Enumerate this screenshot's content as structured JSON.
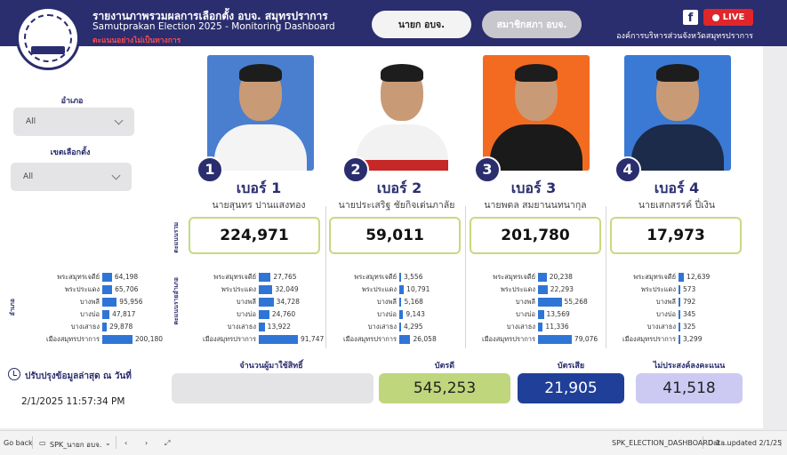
{
  "header": {
    "title": "รายงานภาพรวมผลการเลือกตั้ง อบจ. สมุทรปราการ",
    "subtitle": "Samutprakan Election 2025 - Monitoring Dashboard",
    "warning": "ตะแนนอย่างไม่เป็นทางการ",
    "tab_mayor": "นายก อบจ.",
    "tab_council": "สมาชิกสภา อบจ.",
    "live_label": "LIVE",
    "org": "องค์การบริหารส่วนจังหวัดสมุทรปราการ"
  },
  "filters": {
    "district_label": "อำเภอ",
    "district_value": "All",
    "zone_label": "เขตเลือกตั้ง",
    "zone_value": "All"
  },
  "side_labels": {
    "total": "ตะแนนรวม",
    "by_district_a": "อำเภอ",
    "by_district_b": "คะแนนรายอำเภอ"
  },
  "districts": [
    "พระสมุทรเจดีย์",
    "พระประแดง",
    "บางพลี",
    "บางบ่อ",
    "บางเสาธง",
    "เมืองสมุทรปราการ"
  ],
  "district_totals": [
    64198,
    65706,
    95956,
    47817,
    29878,
    200180
  ],
  "district_totals_text": [
    "64,198",
    "65,706",
    "95,956",
    "47,817",
    "29,878",
    "200,180"
  ],
  "candidates": [
    {
      "badge": "1",
      "number_label": "เบอร์ 1",
      "name": "นายสุนทร ปานแสงทอง",
      "total": "224,971",
      "district_values": [
        27765,
        32049,
        34728,
        24760,
        13922,
        91747
      ],
      "district_text": [
        "27,765",
        "32,049",
        "34,728",
        "24,760",
        "13,922",
        "91,747"
      ]
    },
    {
      "badge": "2",
      "number_label": "เบอร์ 2",
      "name": "นายประเสริฐ ชัยกิจเด่นภาลัย",
      "total": "59,011",
      "district_values": [
        3556,
        10791,
        5168,
        9143,
        4295,
        26058
      ],
      "district_text": [
        "3,556",
        "10,791",
        "5,168",
        "9,143",
        "4,295",
        "26,058"
      ]
    },
    {
      "badge": "3",
      "number_label": "เบอร์ 3",
      "name": "นายพดล สมยานนทนากุล",
      "total": "201,780",
      "district_values": [
        20238,
        22293,
        55268,
        13569,
        11336,
        79076
      ],
      "district_text": [
        "20,238",
        "22,293",
        "55,268",
        "13,569",
        "11,336",
        "79,076"
      ]
    },
    {
      "badge": "4",
      "number_label": "เบอร์ 4",
      "name": "นายเสกสรรค์ ปี่เงิน",
      "total": "17,973",
      "district_values": [
        12639,
        573,
        792,
        345,
        325,
        3299
      ],
      "district_text": [
        "12,639",
        "573",
        "792",
        "345",
        "325",
        "3,299"
      ]
    }
  ],
  "update": {
    "label": "ปรับปรุงข้อมูลล่าสุด ณ วันที่",
    "timestamp": "2/1/2025 11:57:34 PM"
  },
  "summary": {
    "eligible_label": "จำนวนผู้มาใช้สิทธิ์",
    "eligible_value": "",
    "good_label": "บัตรดี",
    "good_value": "545,253",
    "bad_label": "บัตรเสีย",
    "bad_value": "21,905",
    "novote_label": "ไม่ประสงค์ลงคะแนน",
    "novote_value": "41,518"
  },
  "statusbar": {
    "go_back": "Go back",
    "tab": "SPK_นายก อบจ.",
    "report": "SPK_ELECTION_DASHBOARD 1 ...",
    "updated": "Data updated 2/1/25"
  },
  "colors": {
    "brand": "#2a2d6e",
    "bar": "#2f75d6",
    "good": "#bfd67c",
    "bad": "#1f3f99",
    "novote": "#cccaf2",
    "live": "#e0262a"
  }
}
